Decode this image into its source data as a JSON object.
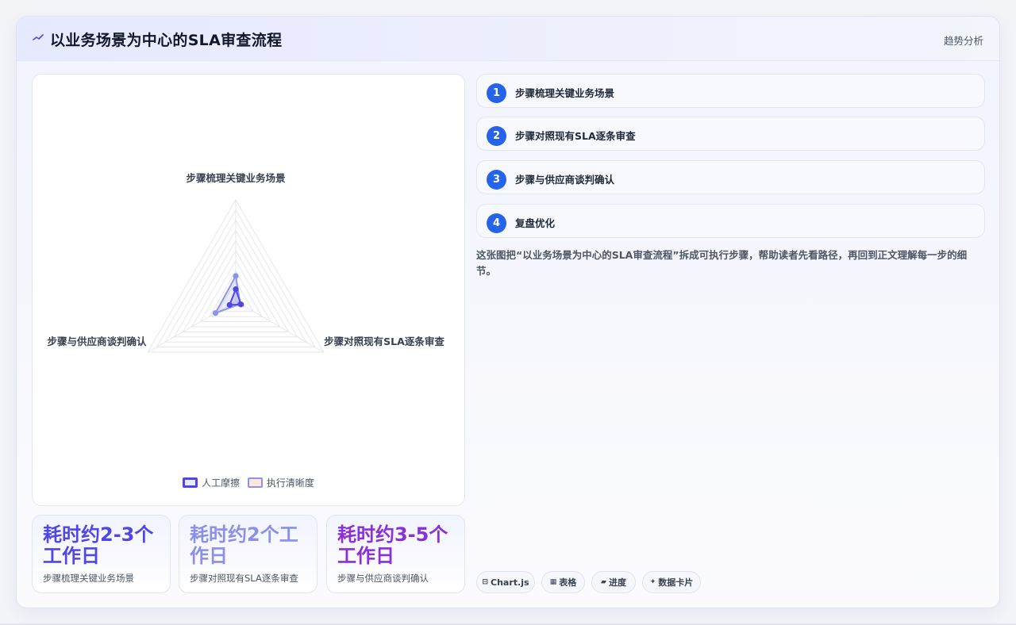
{
  "header": {
    "title": "以业务场景为中心的SLA审查流程",
    "tag": "趋势分析",
    "icon": "chart-line-icon"
  },
  "chart_data": {
    "type": "radar",
    "axes": [
      "步骤梳理关键业务场景",
      "步骤对照现有SLA逐条审查",
      "步骤与供应商谈判确认"
    ],
    "rmax": 10,
    "series": [
      {
        "name": "人工摩擦",
        "values": [
          1.2,
          0.6,
          0.7
        ],
        "color": "#4f46e5"
      },
      {
        "name": "执行清晰度",
        "values": [
          2.5,
          0.5,
          2.3
        ],
        "color": "#8b95e8"
      }
    ]
  },
  "stats": [
    {
      "value": "耗时约2-3个工作日",
      "label": "步骤梳理关键业务场景"
    },
    {
      "value": "耗时约2个工作日",
      "label": "步骤对照现有SLA逐条审查"
    },
    {
      "value": "耗时约3-5个工作日",
      "label": "步骤与供应商谈判确认"
    }
  ],
  "steps": [
    {
      "num": "1",
      "label": "步骤梳理关键业务场景"
    },
    {
      "num": "2",
      "label": "步骤对照现有SLA逐条审查"
    },
    {
      "num": "3",
      "label": "步骤与供应商谈判确认"
    },
    {
      "num": "4",
      "label": "复盘优化"
    }
  ],
  "description": "这张图把“以业务场景为中心的SLA审查流程”拆成可执行步骤，帮助读者先看路径，再回到正文理解每一步的细节。",
  "chips": [
    {
      "icon": "table-icon",
      "glyph": "⊟",
      "label": "Chart.js"
    },
    {
      "icon": "grid-icon",
      "glyph": "▦",
      "label": "表格"
    },
    {
      "icon": "progress-icon",
      "glyph": "▰",
      "label": "进度"
    },
    {
      "icon": "sparkle-icon",
      "glyph": "✦",
      "label": "数据卡片"
    }
  ]
}
